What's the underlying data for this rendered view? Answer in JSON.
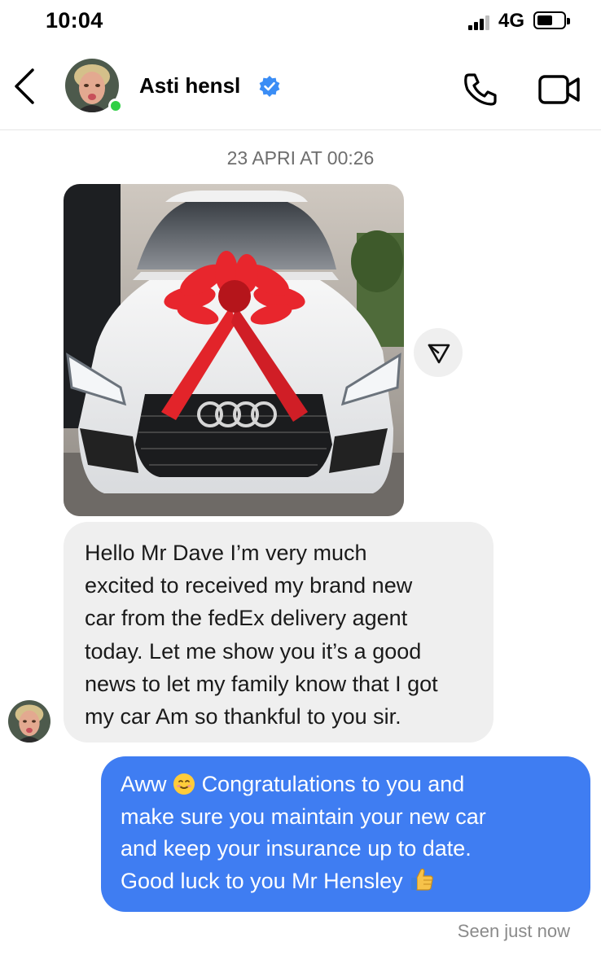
{
  "status_bar": {
    "time": "10:04",
    "network": "4G",
    "icons": [
      "signal-bars-icon",
      "battery-icon"
    ]
  },
  "header": {
    "back_icon": "chevron-left-icon",
    "contact_name": "Asti hensl",
    "verified_icon": "verified-badge-icon",
    "online": true,
    "call_icon": "phone-icon",
    "video_icon": "video-camera-icon"
  },
  "conversation": {
    "timestamp": "23 APRI AT 00:26",
    "photo_message": {
      "icon": "photo-white-car-red-bow",
      "share_icon": "send-icon"
    },
    "incoming_message": {
      "lines": [
        "Hello Mr Dave I’m very much",
        "excited to received my brand new",
        "car from the fedEx delivery agent",
        "today. Let me show you it’s a good",
        "news to let my family know that I got",
        "my car Am so thankful to you sir."
      ]
    },
    "outgoing_message": {
      "line1_before": "Aww",
      "line1_after": "Congratulations to you and",
      "line2": "make sure you maintain your new car",
      "line3": "and keep your insurance up to date.",
      "line4": "Good luck to you Mr Hensley",
      "emoji_smile": "smiling-face-emoji",
      "emoji_thumbs": "thumbs-up-emoji"
    },
    "seen_status": "Seen just now"
  },
  "colors": {
    "outgoing_bubble": "#3f7df2",
    "incoming_bubble": "#efefef",
    "online": "#2fcf45",
    "verified": "#3b8df5"
  }
}
